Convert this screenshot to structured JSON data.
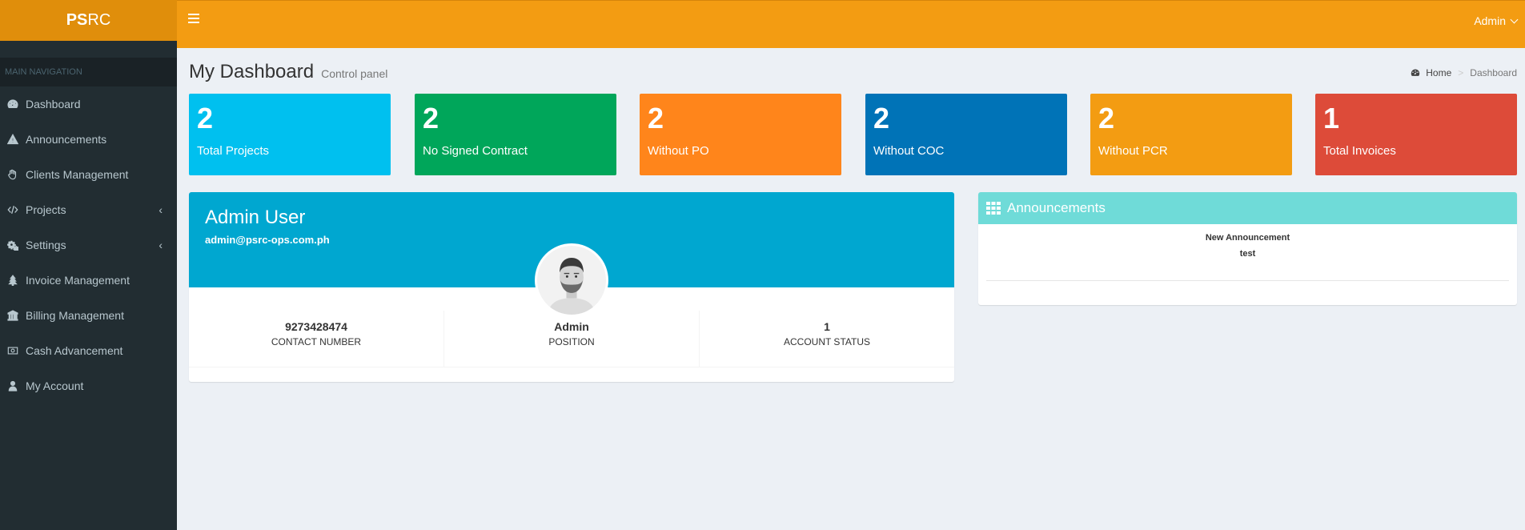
{
  "brand": {
    "bold": "PS",
    "rest": "RC"
  },
  "sidebar": {
    "header": "MAIN NAVIGATION",
    "items": [
      {
        "label": "Dashboard",
        "icon": "dashboard-icon",
        "has_children": false
      },
      {
        "label": "Announcements",
        "icon": "warning-icon",
        "has_children": false
      },
      {
        "label": "Clients Management",
        "icon": "hand-icon",
        "has_children": false
      },
      {
        "label": "Projects",
        "icon": "code-icon",
        "has_children": true
      },
      {
        "label": "Settings",
        "icon": "cogs-icon",
        "has_children": true
      },
      {
        "label": "Invoice Management",
        "icon": "tree-icon",
        "has_children": false
      },
      {
        "label": "Billing Management",
        "icon": "bank-icon",
        "has_children": false
      },
      {
        "label": "Cash Advancement",
        "icon": "money-icon",
        "has_children": false
      },
      {
        "label": "My Account",
        "icon": "user-icon",
        "has_children": false
      }
    ]
  },
  "topbar": {
    "user": "Admin"
  },
  "header": {
    "title": "My Dashboard",
    "subtitle": "Control panel"
  },
  "breadcrumb": {
    "home": "Home",
    "current": "Dashboard"
  },
  "stat_boxes": [
    {
      "value": "2",
      "label": "Total Projects",
      "color": "#00c0ef"
    },
    {
      "value": "2",
      "label": "No Signed Contract",
      "color": "#00a65a"
    },
    {
      "value": "2",
      "label": "Without PO",
      "color": "#ff851b"
    },
    {
      "value": "2",
      "label": "Without COC",
      "color": "#0073b7"
    },
    {
      "value": "2",
      "label": "Without PCR",
      "color": "#f39c12"
    },
    {
      "value": "1",
      "label": "Total Invoices",
      "color": "#dd4b39"
    }
  ],
  "profile": {
    "name": "Admin User",
    "email": "admin@psrc-ops.com.ph",
    "stats": [
      {
        "value": "9273428474",
        "label": "CONTACT NUMBER"
      },
      {
        "value": "Admin",
        "label": "POSITION"
      },
      {
        "value": "1",
        "label": "ACCOUNT STATUS"
      }
    ]
  },
  "announcements": {
    "title": "Announcements",
    "items": [
      {
        "title": "New Announcement",
        "text": "test"
      }
    ]
  },
  "colors": {
    "topbar": "#f39c12",
    "logo": "#e08e0b",
    "sidebar": "#222d32",
    "widget_head": "#00a7d0",
    "announcement_head": "#6fdbd8"
  }
}
